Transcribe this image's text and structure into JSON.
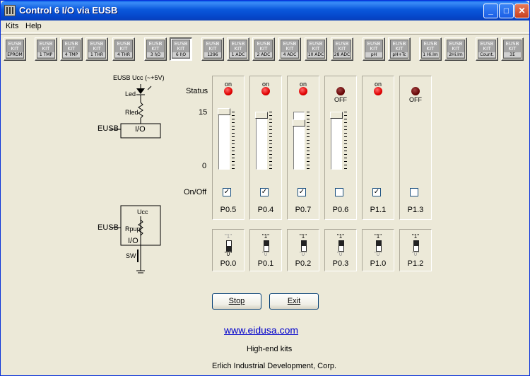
{
  "window": {
    "title": "Control 6 I/O via EUSB"
  },
  "menu": {
    "kits": "Kits",
    "help": "Help"
  },
  "toolbar": {
    "kits": [
      {
        "l1": "EUSB",
        "l2": "KIT",
        "l3": "EPROM"
      },
      {
        "l1": "EUSB",
        "l2": "KIT",
        "l3": "1 TMP"
      },
      {
        "l1": "EUSB",
        "l2": "KIT",
        "l3": "4 TMP"
      },
      {
        "l1": "EUSB",
        "l2": "KIT",
        "l3": "1 THR"
      },
      {
        "l1": "EUSB",
        "l2": "KIT",
        "l3": "4 THR"
      },
      {
        "l1": "EUSB",
        "l2": "KIT",
        "l3": "3 I\\O"
      },
      {
        "l1": "EUSB",
        "l2": "KIT",
        "l3": "6 I\\O"
      },
      {
        "l1": "EUSB",
        "l2": "KIT",
        "l3": "1296"
      },
      {
        "l1": "EUSB",
        "l2": "KIT",
        "l3": "1 ADC"
      },
      {
        "l1": "EUSB",
        "l2": "KIT",
        "l3": "2 ADC"
      },
      {
        "l1": "EUSB",
        "l2": "KIT",
        "l3": "4 ADC"
      },
      {
        "l1": "EUSB",
        "l2": "KIT",
        "l3": "10 ADC"
      },
      {
        "l1": "EUSB",
        "l2": "KIT",
        "l3": "28 ADC"
      },
      {
        "l1": "EUSB",
        "l2": "KIT",
        "l3": "pH"
      },
      {
        "l1": "EUSB",
        "l2": "KIT",
        "l3": "pH+Tc"
      },
      {
        "l1": "EUSB",
        "l2": "KIT",
        "l3": "1 Hi.Im"
      },
      {
        "l1": "EUSB",
        "l2": "KIT",
        "l3": "2Hi.Im"
      },
      {
        "l1": "EUSB",
        "l2": "KIT",
        "l3": "Count."
      },
      {
        "l1": "EUSB",
        "l2": "KIT",
        "l3": "3Σ"
      }
    ]
  },
  "schematic": {
    "vcc": "EUSB Ucc (~+5V)",
    "led": "Led",
    "rled": "Rled",
    "eusb1": "EUSB",
    "io1": "I/O",
    "vcc2": "Ucc",
    "eusb2": "EUSB",
    "rpup": "Rpup",
    "io2": "I/O",
    "sw": "SW"
  },
  "labels": {
    "status": "Status",
    "max": "15",
    "min": "0",
    "onoff": "On/Off"
  },
  "outputs": [
    {
      "name": "P0.5",
      "status": "on",
      "level": 15,
      "checked": true
    },
    {
      "name": "P0.4",
      "status": "on",
      "level": 14,
      "checked": true
    },
    {
      "name": "P0.7",
      "status": "on",
      "level": 12,
      "checked": true
    },
    {
      "name": "P0.6",
      "status": "OFF",
      "level": 14,
      "checked": false
    },
    {
      "name": "P1.1",
      "status": "on",
      "level": null,
      "checked": true
    },
    {
      "name": "P1.3",
      "status": "OFF",
      "level": null,
      "checked": false
    }
  ],
  "inputs": [
    {
      "name": "P0.0",
      "top": "\"1\"",
      "bottom": "\"0\"",
      "state": "0"
    },
    {
      "name": "P0.1",
      "top": "\"1\"",
      "bottom": "\"0\"",
      "state": "1"
    },
    {
      "name": "P0.2",
      "top": "\"1\"",
      "bottom": "\"0\"",
      "state": "1"
    },
    {
      "name": "P0.3",
      "top": "\"1\"",
      "bottom": "\"0\"",
      "state": "1"
    },
    {
      "name": "P1.0",
      "top": "\"1\"",
      "bottom": "\"0\"",
      "state": "1"
    },
    {
      "name": "P1.2",
      "top": "\"1\"",
      "bottom": "\"0\"",
      "state": "1"
    }
  ],
  "buttons": {
    "stop": "Stop",
    "exit": "Exit"
  },
  "footer": {
    "link": "www.eidusa.com",
    "tagline": "High-end kits",
    "company": "Erlich Industrial Development, Corp."
  }
}
